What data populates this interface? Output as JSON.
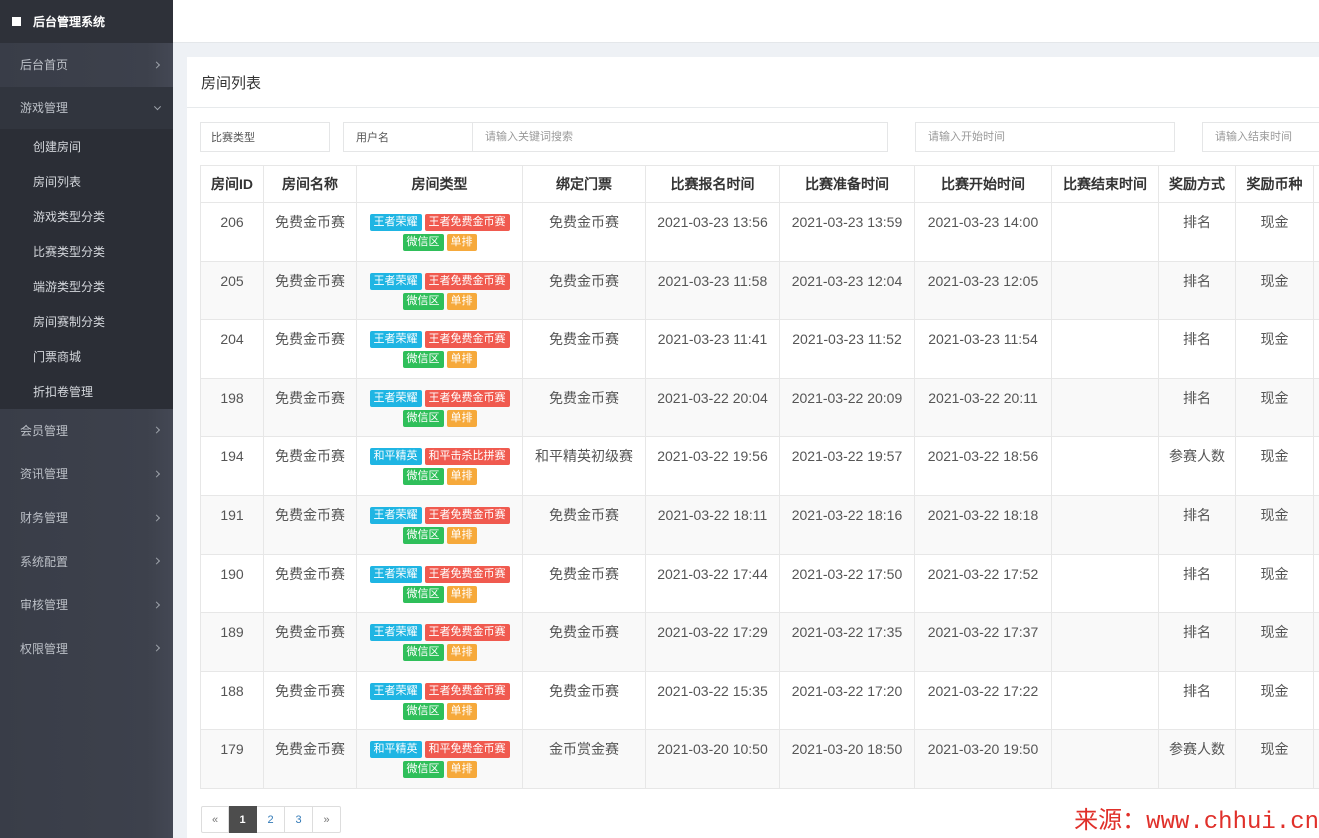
{
  "app": {
    "title": "后台管理系统"
  },
  "sidebar": {
    "items": [
      {
        "label": "后台首页"
      },
      {
        "label": "游戏管理",
        "expanded": true,
        "children": [
          "创建房间",
          "房间列表",
          "游戏类型分类",
          "比赛类型分类",
          "端游类型分类",
          "房间赛制分类",
          "门票商城",
          "折扣卷管理"
        ]
      },
      {
        "label": "会员管理"
      },
      {
        "label": "资讯管理"
      },
      {
        "label": "财务管理"
      },
      {
        "label": "系统配置"
      },
      {
        "label": "审核管理"
      },
      {
        "label": "权限管理"
      }
    ]
  },
  "page": {
    "title": "房间列表"
  },
  "filters": {
    "match_type": "比赛类型",
    "search_field": "用户名",
    "keyword_placeholder": "请输入关键词搜索",
    "start_time_placeholder": "请输入开始时间",
    "end_time_placeholder": "请输入结束时间"
  },
  "table": {
    "columns": [
      "房间ID",
      "房间名称",
      "房间类型",
      "绑定门票",
      "比赛报名时间",
      "比赛准备时间",
      "比赛开始时间",
      "比赛结束时间",
      "奖励方式",
      "奖励币种"
    ],
    "rows": [
      {
        "id": "206",
        "name": "免费金币赛",
        "tags": {
          "game": "王者荣耀",
          "match": "王者免费金币赛",
          "region": "微信区",
          "mode": "单排"
        },
        "ticket": "免费金币赛",
        "signup_time": "2021-03-23 13:56",
        "ready_time": "2021-03-23 13:59",
        "start_time": "2021-03-23 14:00",
        "end_time": "",
        "reward_method": "排名",
        "reward_currency": "现金"
      },
      {
        "id": "205",
        "name": "免费金币赛",
        "tags": {
          "game": "王者荣耀",
          "match": "王者免费金币赛",
          "region": "微信区",
          "mode": "单排"
        },
        "ticket": "免费金币赛",
        "signup_time": "2021-03-23 11:58",
        "ready_time": "2021-03-23 12:04",
        "start_time": "2021-03-23 12:05",
        "end_time": "",
        "reward_method": "排名",
        "reward_currency": "现金"
      },
      {
        "id": "204",
        "name": "免费金币赛",
        "tags": {
          "game": "王者荣耀",
          "match": "王者免费金币赛",
          "region": "微信区",
          "mode": "单排"
        },
        "ticket": "免费金币赛",
        "signup_time": "2021-03-23 11:41",
        "ready_time": "2021-03-23 11:52",
        "start_time": "2021-03-23 11:54",
        "end_time": "",
        "reward_method": "排名",
        "reward_currency": "现金"
      },
      {
        "id": "198",
        "name": "免费金币赛",
        "tags": {
          "game": "王者荣耀",
          "match": "王者免费金币赛",
          "region": "微信区",
          "mode": "单排"
        },
        "ticket": "免费金币赛",
        "signup_time": "2021-03-22 20:04",
        "ready_time": "2021-03-22 20:09",
        "start_time": "2021-03-22 20:11",
        "end_time": "",
        "reward_method": "排名",
        "reward_currency": "现金"
      },
      {
        "id": "194",
        "name": "免费金币赛",
        "tags": {
          "game": "和平精英",
          "match": "和平击杀比拼赛",
          "region": "微信区",
          "mode": "单排"
        },
        "ticket": "和平精英初级赛",
        "signup_time": "2021-03-22 19:56",
        "ready_time": "2021-03-22 19:57",
        "start_time": "2021-03-22 18:56",
        "end_time": "",
        "reward_method": "参赛人数",
        "reward_currency": "现金"
      },
      {
        "id": "191",
        "name": "免费金币赛",
        "tags": {
          "game": "王者荣耀",
          "match": "王者免费金币赛",
          "region": "微信区",
          "mode": "单排"
        },
        "ticket": "免费金币赛",
        "signup_time": "2021-03-22 18:11",
        "ready_time": "2021-03-22 18:16",
        "start_time": "2021-03-22 18:18",
        "end_time": "",
        "reward_method": "排名",
        "reward_currency": "现金"
      },
      {
        "id": "190",
        "name": "免费金币赛",
        "tags": {
          "game": "王者荣耀",
          "match": "王者免费金币赛",
          "region": "微信区",
          "mode": "单排"
        },
        "ticket": "免费金币赛",
        "signup_time": "2021-03-22 17:44",
        "ready_time": "2021-03-22 17:50",
        "start_time": "2021-03-22 17:52",
        "end_time": "",
        "reward_method": "排名",
        "reward_currency": "现金"
      },
      {
        "id": "189",
        "name": "免费金币赛",
        "tags": {
          "game": "王者荣耀",
          "match": "王者免费金币赛",
          "region": "微信区",
          "mode": "单排"
        },
        "ticket": "免费金币赛",
        "signup_time": "2021-03-22 17:29",
        "ready_time": "2021-03-22 17:35",
        "start_time": "2021-03-22 17:37",
        "end_time": "",
        "reward_method": "排名",
        "reward_currency": "现金"
      },
      {
        "id": "188",
        "name": "免费金币赛",
        "tags": {
          "game": "王者荣耀",
          "match": "王者免费金币赛",
          "region": "微信区",
          "mode": "单排"
        },
        "ticket": "免费金币赛",
        "signup_time": "2021-03-22 15:35",
        "ready_time": "2021-03-22 17:20",
        "start_time": "2021-03-22 17:22",
        "end_time": "",
        "reward_method": "排名",
        "reward_currency": "现金"
      },
      {
        "id": "179",
        "name": "免费金币赛",
        "tags": {
          "game": "和平精英",
          "match": "和平免费金币赛",
          "region": "微信区",
          "mode": "单排"
        },
        "ticket": "金币赏金赛",
        "signup_time": "2021-03-20 10:50",
        "ready_time": "2021-03-20 18:50",
        "start_time": "2021-03-20 19:50",
        "end_time": "",
        "reward_method": "参赛人数",
        "reward_currency": "现金"
      }
    ]
  },
  "pagination": {
    "prev": "«",
    "pages": [
      "1",
      "2",
      "3"
    ],
    "current": "1",
    "next": "»"
  },
  "watermark": "来源：www.chhui.cn",
  "colors": {
    "tags": {
      "game": "#1fb5e3",
      "match": "#f05a4f",
      "region": "#2fbf5a",
      "mode": "#f6a93b"
    },
    "pagination_active": "#4d4d4d",
    "watermark": "#e0302a"
  }
}
